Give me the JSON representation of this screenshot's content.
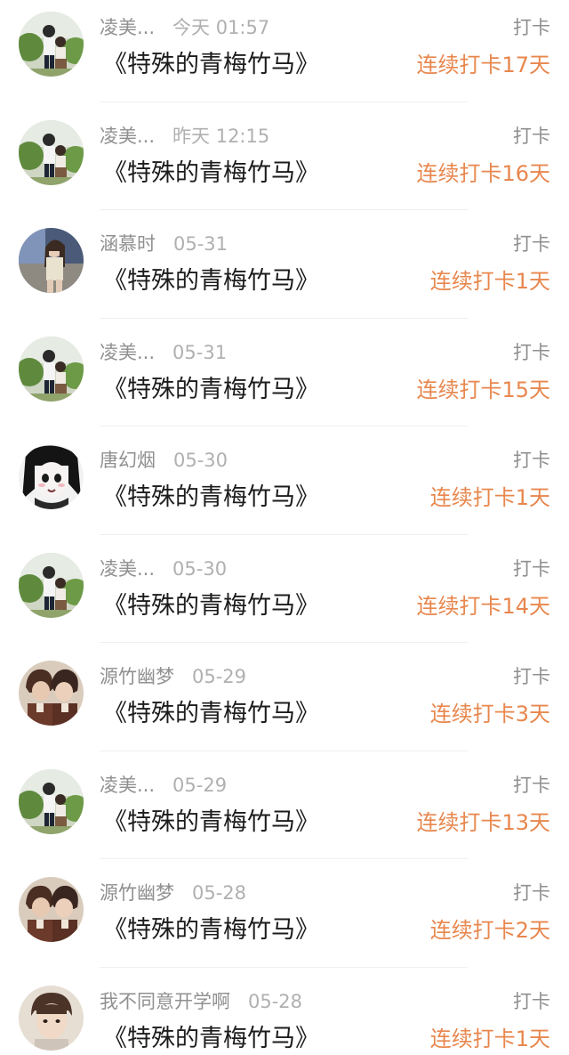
{
  "list": {
    "items": [
      {
        "name": "凌美...",
        "time": "今天 01:57",
        "title": "《特殊的青梅竹马》",
        "action": "打卡",
        "streak": "连续打卡17天",
        "avatar_icon": "avatar-couple-garden-icon"
      },
      {
        "name": "凌美...",
        "time": "昨天 12:15",
        "title": "《特殊的青梅竹马》",
        "action": "打卡",
        "streak": "连续打卡16天",
        "avatar_icon": "avatar-couple-garden-icon"
      },
      {
        "name": "涵慕时",
        "time": "05-31",
        "title": "《特殊的青梅竹马》",
        "action": "打卡",
        "streak": "连续打卡1天",
        "avatar_icon": "avatar-girl-window-icon"
      },
      {
        "name": "凌美...",
        "time": "05-31",
        "title": "《特殊的青梅竹马》",
        "action": "打卡",
        "streak": "连续打卡15天",
        "avatar_icon": "avatar-couple-garden-icon"
      },
      {
        "name": "唐幻烟",
        "time": "05-30",
        "title": "《特殊的青梅竹马》",
        "action": "打卡",
        "streak": "连续打卡1天",
        "avatar_icon": "avatar-manga-girl-icon"
      },
      {
        "name": "凌美...",
        "time": "05-30",
        "title": "《特殊的青梅竹马》",
        "action": "打卡",
        "streak": "连续打卡14天",
        "avatar_icon": "avatar-couple-garden-icon"
      },
      {
        "name": "源竹幽梦",
        "time": "05-29",
        "title": "《特殊的青梅竹马》",
        "action": "打卡",
        "streak": "连续打卡3天",
        "avatar_icon": "avatar-two-boys-icon"
      },
      {
        "name": "凌美...",
        "time": "05-29",
        "title": "《特殊的青梅竹马》",
        "action": "打卡",
        "streak": "连续打卡13天",
        "avatar_icon": "avatar-couple-garden-icon"
      },
      {
        "name": "源竹幽梦",
        "time": "05-28",
        "title": "《特殊的青梅竹马》",
        "action": "打卡",
        "streak": "连续打卡2天",
        "avatar_icon": "avatar-two-boys-icon"
      },
      {
        "name": "我不同意开学啊",
        "time": "05-28",
        "title": "《特殊的青梅竹马》",
        "action": "打卡",
        "streak": "连续打卡1天",
        "avatar_icon": "avatar-boy-portrait-icon"
      }
    ]
  },
  "colors": {
    "streak": "#e8874e",
    "name": "#909090",
    "time": "#b0b0b0",
    "title": "#1c1c1c",
    "action": "#8f8f8f"
  }
}
